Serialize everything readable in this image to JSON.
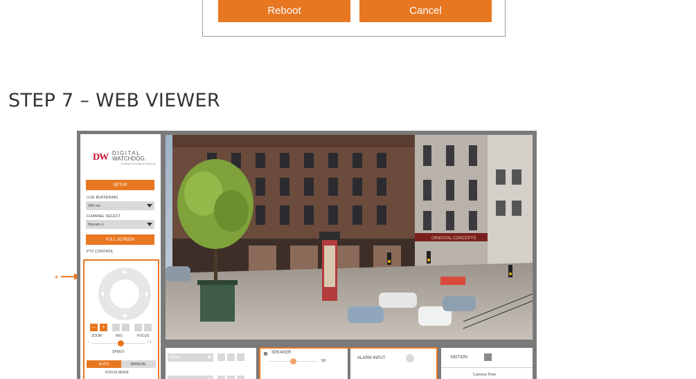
{
  "dialog": {
    "reboot_label": "Reboot",
    "cancel_label": "Cancel"
  },
  "heading": "STEP 7 – WEB VIEWER",
  "annotation": {
    "marker": "*"
  },
  "viewer": {
    "logo": {
      "mark": "DW",
      "line1": "DIGITAL",
      "line2": "WATCHDOG.",
      "tagline": "Complete Surveillance Solutions"
    },
    "sidebar": {
      "setup_label": "SETUP",
      "live_buffering_label": "LIVE BUFFERING",
      "live_buffering_value": "500 ms",
      "channel_select_label": "CHANNEL SELECT",
      "channel_select_value": "Stream-1",
      "full_screen_label": "FULL SCREEN",
      "ptz_control_label": "PTZ CONTROL",
      "ptz": {
        "zoom_out": "–",
        "zoom_in": "+",
        "zoom_label": "ZOOM",
        "iris_label": "IRIS",
        "focus_label": "FOCUS",
        "speed_min": "–",
        "speed_max": "+ 1",
        "speed_label": "SPEED",
        "speed_level": 0.55,
        "auto_label": "AUTO",
        "manual_label": "MANUAL",
        "focus_mode_label": "FOCUS MODE"
      }
    },
    "bottom": {
      "preset_placeholder": "Preset",
      "speaker_label": "SPEAKER",
      "speaker_value": "50",
      "speaker_level": 0.5,
      "alarm_input_label": "ALARM INPUT",
      "motion_label": "MOTION",
      "camera_time_label": "Camera Time"
    },
    "camera": {
      "shop_sign": "ORIENTAL CONCEPTS"
    }
  },
  "colors": {
    "accent": "#e87722",
    "frame": "#7a7a7a"
  }
}
